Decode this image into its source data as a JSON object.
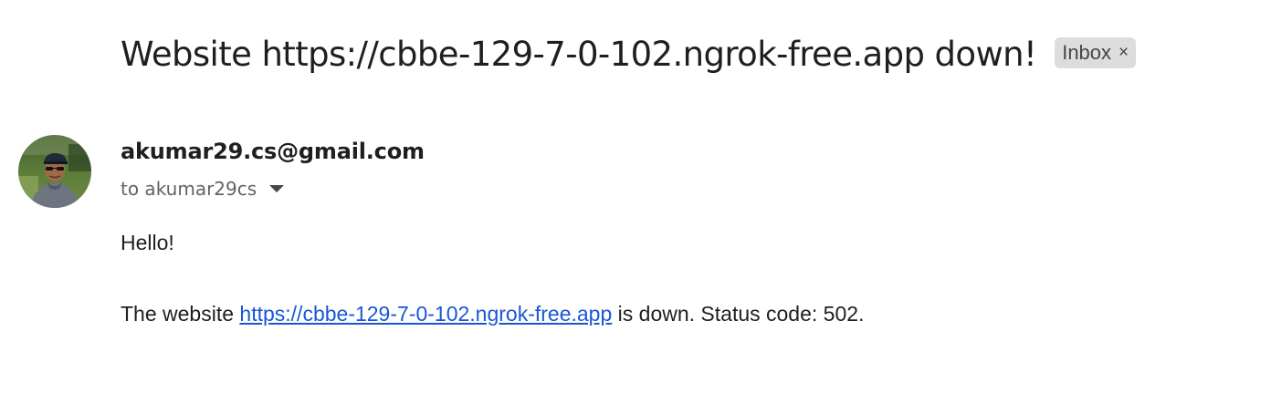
{
  "email": {
    "subject": "Website https://cbbe-129-7-0-102.ngrok-free.app down!",
    "label": {
      "text": "Inbox",
      "remove_symbol": "×"
    },
    "sender": {
      "address": "akumar29.cs@gmail.com",
      "avatar_icon": "user-avatar-photo"
    },
    "recipient_line": "to akumar29cs",
    "body": {
      "greeting": "Hello!",
      "message_prefix": "The website",
      "link_text": "https://cbbe-129-7-0-102.ngrok-free.app",
      "message_suffix": "is down. Status code: 502."
    }
  },
  "colors": {
    "link": "#1a56d6",
    "chip_background": "#dddddd",
    "text_primary": "#1f1f1f",
    "text_secondary": "#5f6368"
  }
}
